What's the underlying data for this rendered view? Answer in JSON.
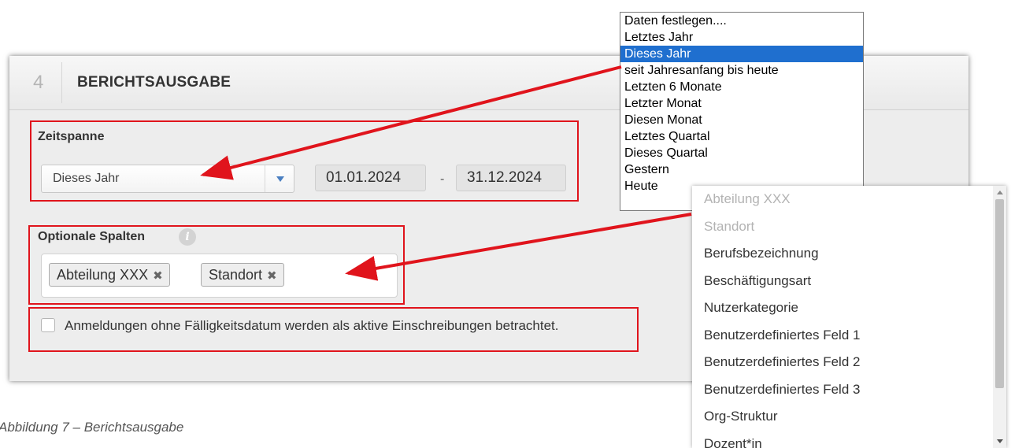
{
  "panel": {
    "step_number": "4",
    "title": "BERICHTSAUSGABE"
  },
  "zeitspanne": {
    "label": "Zeitspanne",
    "selected": "Dieses Jahr",
    "date_from": "01.01.2024",
    "date_separator": "-",
    "date_to": "31.12.2024"
  },
  "optionale_spalten": {
    "label": "Optionale Spalten",
    "info_icon_glyph": "i",
    "tags": [
      "Abteilung XXX",
      "Standort"
    ],
    "remove_glyph": "✖"
  },
  "checkbox": {
    "label": "Anmeldungen ohne Fälligkeitsdatum werden als aktive Einschreibungen betrachtet.",
    "checked": false
  },
  "timespan_dropdown": {
    "options": [
      "Daten festlegen....",
      "Letztes Jahr",
      "Dieses Jahr",
      "seit Jahresanfang bis heute",
      "Letzten 6 Monate",
      "Letzter Monat",
      "Diesen Monat",
      "Letztes Quartal",
      "Dieses Quartal",
      "Gestern",
      "Heute"
    ],
    "selected_index": 2
  },
  "columns_dropdown": {
    "options": [
      "Abteilung XXX",
      "Standort",
      "Berufsbezeichnung",
      "Beschäftigungsart",
      "Nutzerkategorie",
      "Benutzerdefiniertes Feld 1",
      "Benutzerdefiniertes Feld 2",
      "Benutzerdefiniertes Feld 3",
      "Org-Struktur",
      "Dozent*in"
    ],
    "disabled_indices": [
      0,
      1
    ]
  },
  "caption": "Abbildung 7 – Berichtsausgabe",
  "colors": {
    "annotation_red": "#e0141c",
    "selection_blue": "#1f6fcf",
    "dropdown_arrow_blue": "#4a7fc1"
  },
  "icons": {
    "select_arrow": "chevron-down-icon",
    "info": "info-icon",
    "tag_remove": "close-icon"
  }
}
